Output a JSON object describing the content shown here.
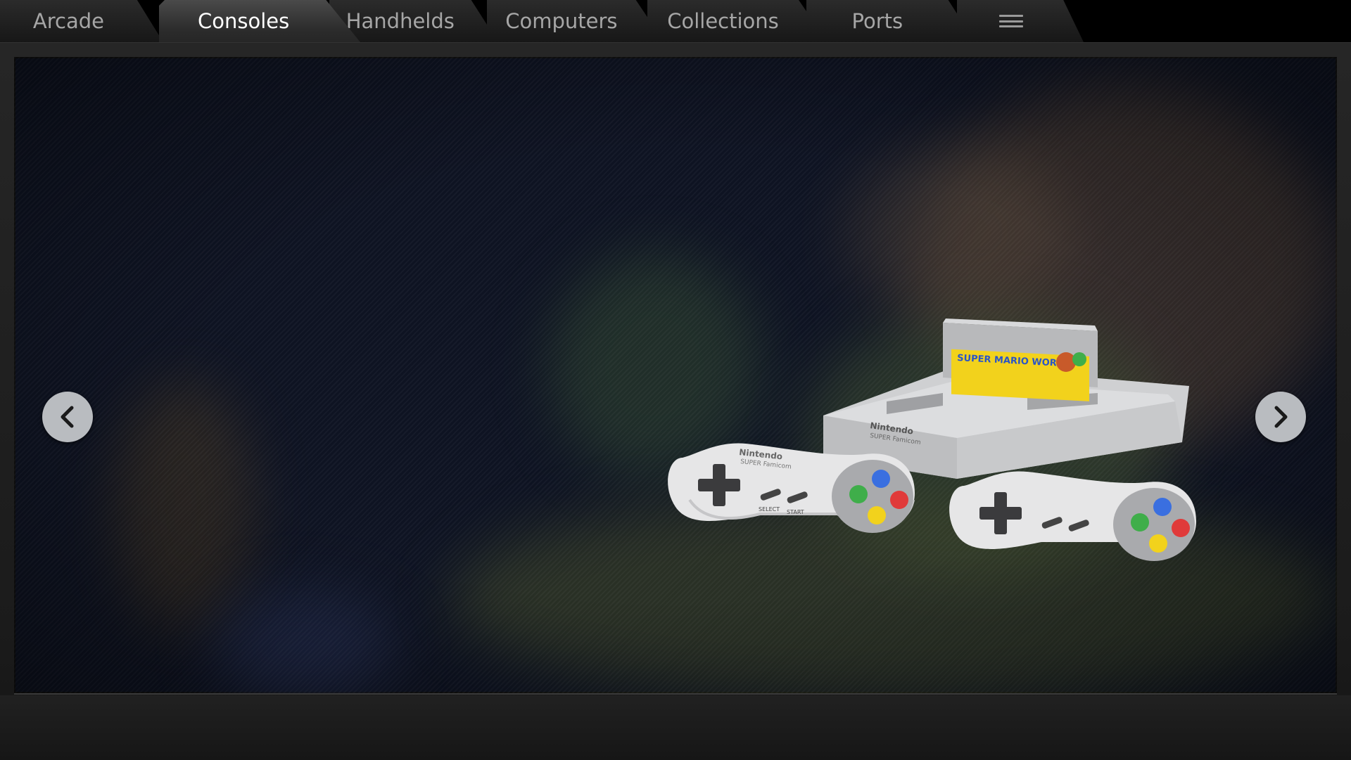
{
  "tabs": [
    {
      "label": "Arcade",
      "active": false
    },
    {
      "label": "Consoles",
      "active": true
    },
    {
      "label": "Handhelds",
      "active": false
    },
    {
      "label": "Computers",
      "active": false
    },
    {
      "label": "Collections",
      "active": false
    },
    {
      "label": "Ports",
      "active": false
    }
  ],
  "menu": {
    "icon": "hamburger-menu-icon"
  },
  "carousel": {
    "prev_icon": "chevron-left-icon",
    "next_icon": "chevron-right-icon"
  },
  "featured_system": {
    "console_brand": "Nintendo",
    "console_model": "SUPER Famicom",
    "cartridge_title": "SUPER MARIO WORLD",
    "controller_brand": "Nintendo",
    "controller_model": "SUPER Famicom",
    "button_labels": [
      "SELECT",
      "START"
    ],
    "face_buttons": [
      "X",
      "A",
      "B",
      "Y"
    ]
  },
  "colors": {
    "active_tab_text": "#ffffff",
    "inactive_tab_text": "#a6a6a6",
    "viewport_bg": "#0e1322",
    "arrow_button": "#b9bcc0",
    "face_button_x": "#3a6fe0",
    "face_button_a": "#e03a3a",
    "face_button_b": "#f2d21c",
    "face_button_y": "#3fae4a"
  }
}
